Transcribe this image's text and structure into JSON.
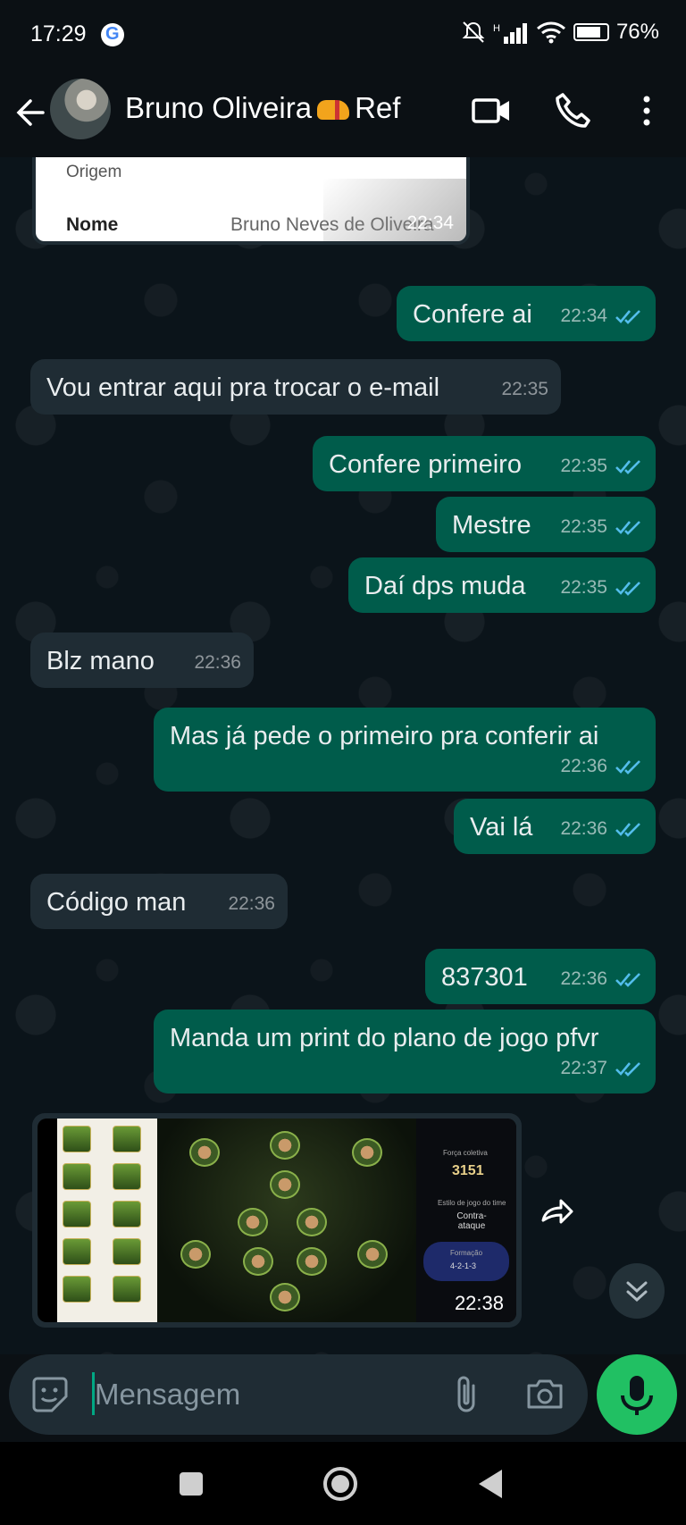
{
  "status_bar": {
    "time": "17:29",
    "battery": "76%"
  },
  "header": {
    "contact_name_part1": "Bruno Oliveira",
    "contact_name_part2": "Ref"
  },
  "quoted_card": {
    "label_origin": "Origem",
    "label_name": "Nome",
    "value_name": "Bruno Neves de Oliveira",
    "time": "22:34"
  },
  "messages": [
    {
      "dir": "out",
      "text": "Confere ai",
      "time": "22:34"
    },
    {
      "dir": "in",
      "text": "Vou entrar aqui pra trocar o e-mail",
      "time": "22:35"
    },
    {
      "dir": "out",
      "text": "Confere primeiro",
      "time": "22:35"
    },
    {
      "dir": "out",
      "text": "Mestre",
      "time": "22:35"
    },
    {
      "dir": "out",
      "text": "Daí dps muda",
      "time": "22:35"
    },
    {
      "dir": "in",
      "text": "Blz mano",
      "time": "22:36"
    },
    {
      "dir": "out",
      "text": "Mas já pede o primeiro pra conferir ai",
      "time": "22:36"
    },
    {
      "dir": "out",
      "text": "Vai lá",
      "time": "22:36"
    },
    {
      "dir": "in",
      "text": "Código man",
      "time": "22:36"
    },
    {
      "dir": "out",
      "text": "837301",
      "time": "22:36"
    },
    {
      "dir": "out",
      "text": "Manda um print do plano de jogo pfvr",
      "time": "22:37"
    }
  ],
  "image_message": {
    "time": "22:38",
    "shot_force_label": "Força coletiva",
    "shot_force_value": "3151",
    "shot_style_label": "Estilo de jogo do time",
    "shot_style_value": "Contra-ataque",
    "shot_formation_label": "Formação",
    "shot_formation_value": "4-2-1-3"
  },
  "input": {
    "placeholder": "Mensagem"
  },
  "colors": {
    "outgoing": "#005c4b",
    "incoming": "#1f2c34",
    "mic": "#21c063",
    "ticks": "#53bdeb"
  }
}
